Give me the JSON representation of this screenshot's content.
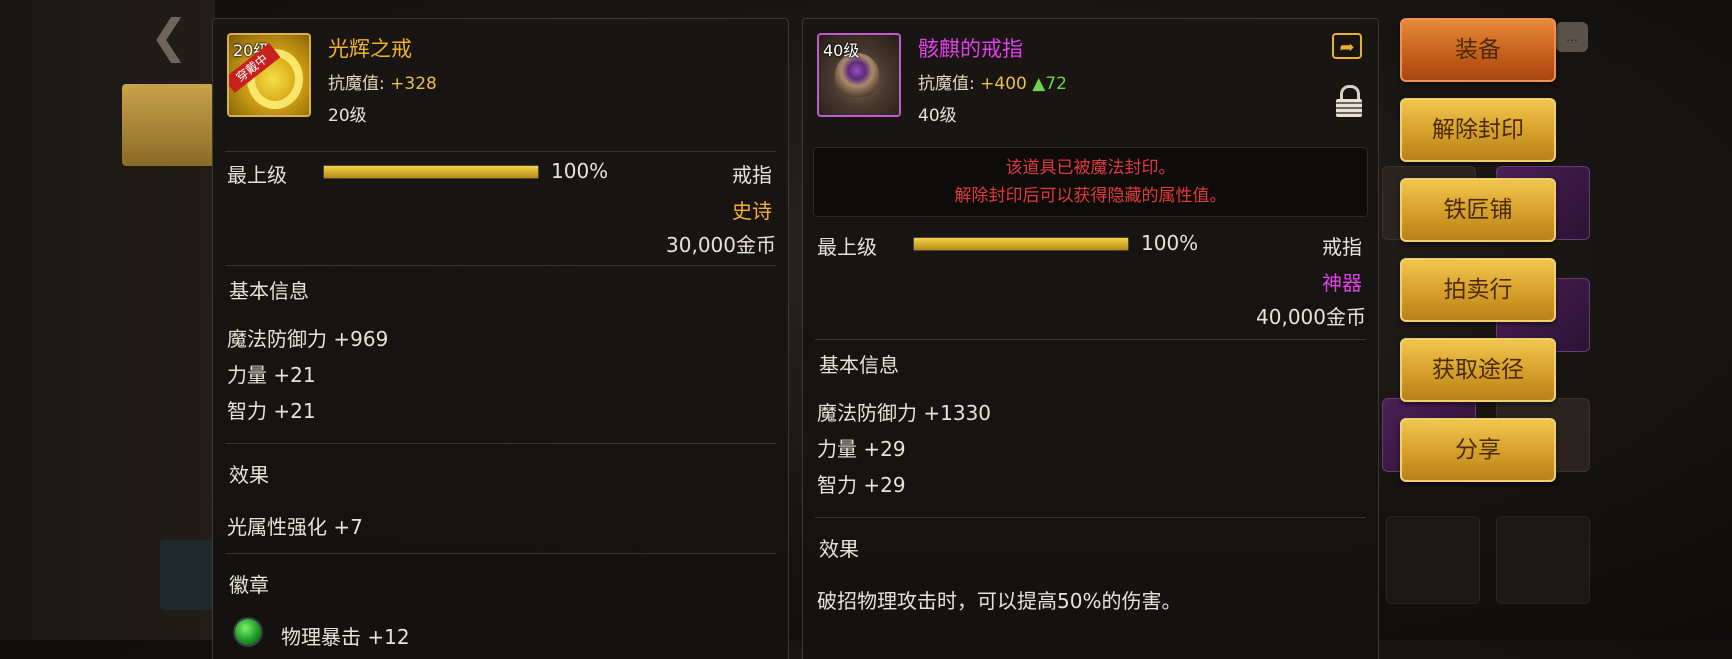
{
  "colors": {
    "legendary": "#f0b030",
    "artifact": "#e040e8",
    "seal_warning": "#e03a3a",
    "stat_increase": "#6fd24a",
    "button_gold": "#d8a22c",
    "button_orange": "#c8601c"
  },
  "equipped_item": {
    "level_badge": "20级",
    "equipped_tag": "穿戴中",
    "name": "光辉之戒",
    "stat_label": "抗魔值:",
    "stat_value": " +328",
    "level": "20级",
    "grade_label": "最上级",
    "grade_percent": "100%",
    "grade_fill": 1.0,
    "type": "戒指",
    "rarity": "史诗",
    "price": "30,000金币",
    "basic_info_title": "基本信息",
    "attributes": [
      "魔法防御力 +969",
      "力量 +21",
      "智力 +21"
    ],
    "effect_title": "效果",
    "effect": "光属性强化 +7",
    "emblem_title": "徽章",
    "emblem_stat": "物理暴击 +12"
  },
  "compare_item": {
    "level_badge": "40级",
    "name": "骸麒的戒指",
    "stat_label": "抗魔值:",
    "stat_value": " +400 ",
    "stat_delta": "▲72",
    "level": "40级",
    "seal_line1": "该道具已被魔法封印。",
    "seal_line2": "解除封印后可以获得隐藏的属性值。",
    "grade_label": "最上级",
    "grade_percent": "100%",
    "grade_fill": 1.0,
    "type": "戒指",
    "rarity": "神器",
    "price": "40,000金币",
    "basic_info_title": "基本信息",
    "attributes": [
      "魔法防御力 +1330",
      "力量 +29",
      "智力 +29"
    ],
    "effect_title": "效果",
    "effect": "破招物理攻击时，可以提高50%的伤害。"
  },
  "actions": [
    "装备",
    "解除封印",
    "铁匠铺",
    "拍卖行",
    "获取途径",
    "分享"
  ]
}
